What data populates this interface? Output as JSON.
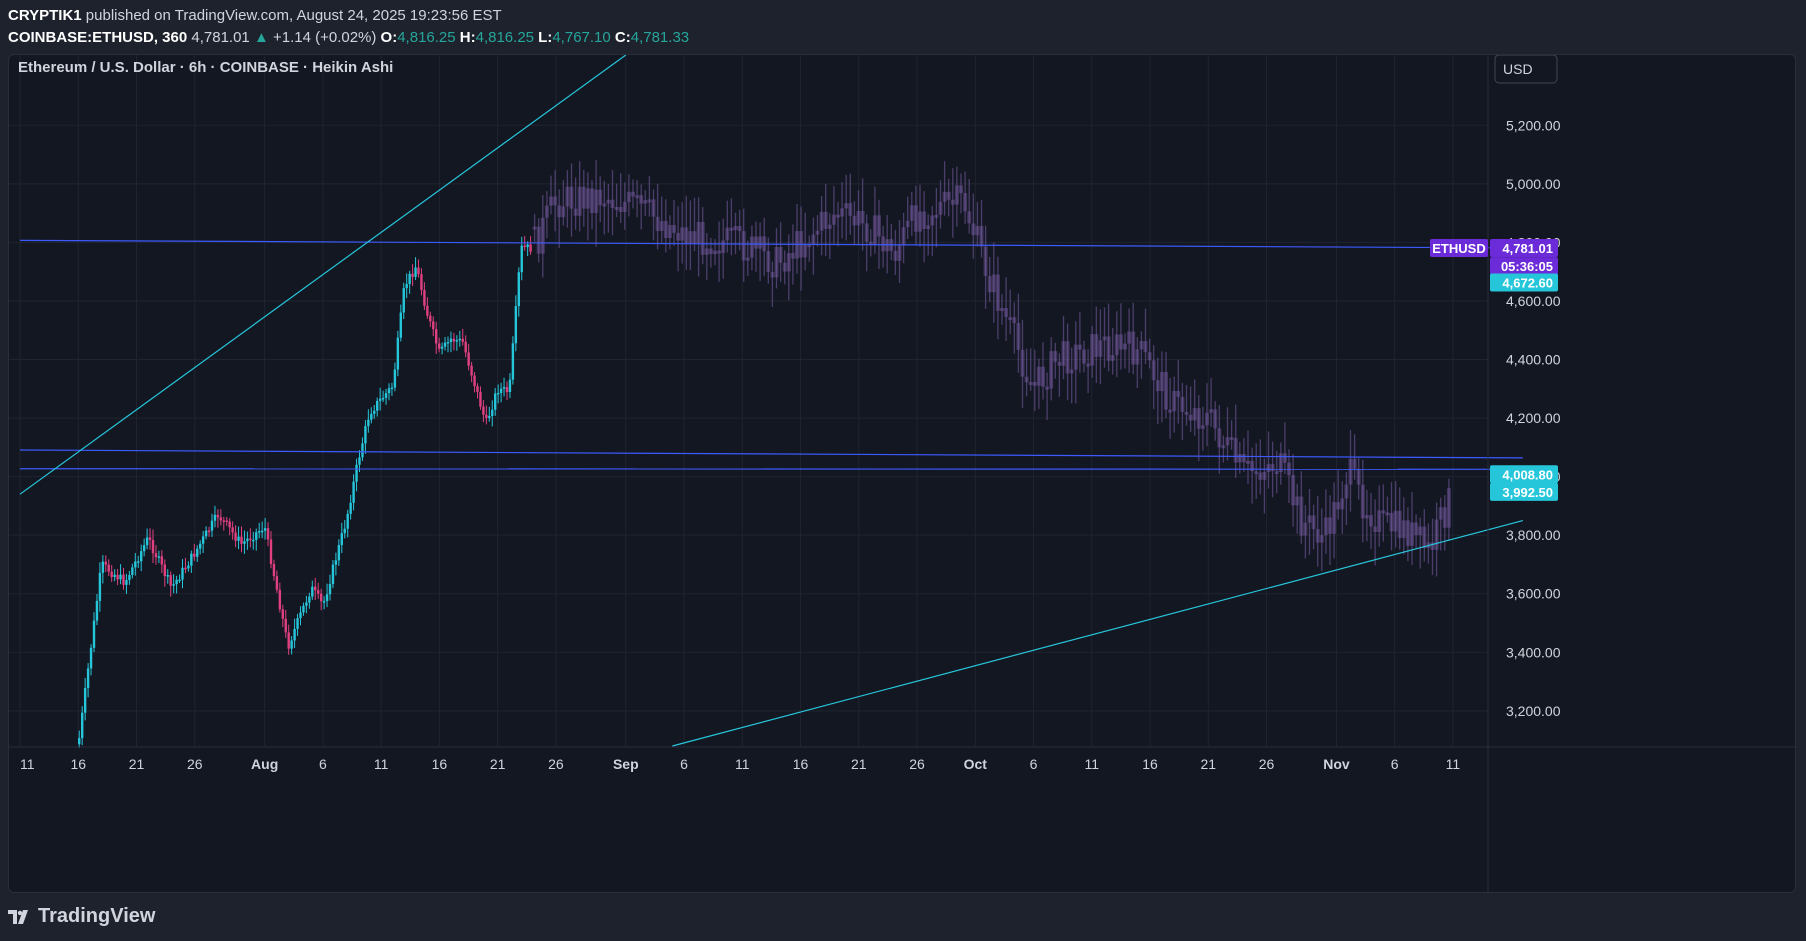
{
  "header": {
    "author": "CRYPTIK1",
    "published_text": "published on TradingView.com, August 24, 2025 19:23:56 EST",
    "symbol": "COINBASE:ETHUSD, 360",
    "last": "4,781.01",
    "change_arrow": "▲",
    "change": "+1.14 (+0.02%)",
    "o_label": "O:",
    "o_value": "4,816.25",
    "h_label": "H:",
    "h_value": "4,816.25",
    "l_label": "L:",
    "l_value": "4,767.10",
    "c_label": "C:",
    "c_value": "4,781.33"
  },
  "chart_title": "Ethereum / U.S. Dollar · 6h · COINBASE · Heikin Ashi",
  "currency_button": "USD",
  "footer_brand": "TradingView",
  "colors": {
    "background": "#131722",
    "up": "#26c6da",
    "down": "#e0407f",
    "projection": "#7b5ea7",
    "trendline": "#26c6da",
    "hline": "#3d5afe",
    "ethusd_badge": "#6c2bd9"
  },
  "chart_data": {
    "type": "candlestick",
    "title": "Ethereum / U.S. Dollar · 6h · COINBASE · Heikin Ashi",
    "x_ticks": [
      "11",
      "16",
      "21",
      "26",
      "Aug",
      "6",
      "11",
      "16",
      "21",
      "26",
      "Sep",
      "6",
      "11",
      "16",
      "21",
      "26",
      "Oct",
      "6",
      "11",
      "16",
      "21",
      "26",
      "Nov",
      "6",
      "11"
    ],
    "y_ticks": [
      "5,200.00",
      "5,000.00",
      "4,800.00",
      "4,600.00",
      "4,400.00",
      "4,200.00",
      "4,000.00",
      "3,800.00",
      "3,600.00",
      "3,400.00",
      "3,200.00"
    ],
    "ylim": [
      3080,
      5440
    ],
    "candle_anchors": [
      {
        "date": "Jul 16",
        "price": 3080
      },
      {
        "date": "Jul 18",
        "price": 3700
      },
      {
        "date": "Jul 20",
        "price": 3640
      },
      {
        "date": "Jul 22",
        "price": 3790
      },
      {
        "date": "Jul 24",
        "price": 3620
      },
      {
        "date": "Jul 26",
        "price": 3740
      },
      {
        "date": "Jul 28",
        "price": 3870
      },
      {
        "date": "Jul 30",
        "price": 3770
      },
      {
        "date": "Aug 1",
        "price": 3830
      },
      {
        "date": "Aug 3",
        "price": 3420
      },
      {
        "date": "Aug 5",
        "price": 3620
      },
      {
        "date": "Aug 6",
        "price": 3560
      },
      {
        "date": "Aug 8",
        "price": 3850
      },
      {
        "date": "Aug 9",
        "price": 4050
      },
      {
        "date": "Aug 10",
        "price": 4220
      },
      {
        "date": "Aug 12",
        "price": 4310
      },
      {
        "date": "Aug 13",
        "price": 4650
      },
      {
        "date": "Aug 14",
        "price": 4720
      },
      {
        "date": "Aug 15",
        "price": 4550
      },
      {
        "date": "Aug 16",
        "price": 4420
      },
      {
        "date": "Aug 17",
        "price": 4470
      },
      {
        "date": "Aug 18",
        "price": 4460
      },
      {
        "date": "Aug 19",
        "price": 4320
      },
      {
        "date": "Aug 20",
        "price": 4180
      },
      {
        "date": "Aug 21",
        "price": 4300
      },
      {
        "date": "Aug 22",
        "price": 4290
      },
      {
        "date": "Aug 23",
        "price": 4780
      },
      {
        "date": "Aug 24",
        "price": 4781
      }
    ],
    "projection_anchors": [
      {
        "date": "Aug 24",
        "price": 4781
      },
      {
        "date": "Aug 26",
        "price": 4940
      },
      {
        "date": "Aug 30",
        "price": 4960
      },
      {
        "date": "Sep 2",
        "price": 4920
      },
      {
        "date": "Sep 6",
        "price": 4830
      },
      {
        "date": "Sep 11",
        "price": 4790
      },
      {
        "date": "Sep 14",
        "price": 4730
      },
      {
        "date": "Sep 16",
        "price": 4800
      },
      {
        "date": "Sep 19",
        "price": 4900
      },
      {
        "date": "Sep 22",
        "price": 4850
      },
      {
        "date": "Sep 24",
        "price": 4760
      },
      {
        "date": "Sep 26",
        "price": 4900
      },
      {
        "date": "Sep 30",
        "price": 4940
      },
      {
        "date": "Oct 2",
        "price": 4700
      },
      {
        "date": "Oct 4",
        "price": 4500
      },
      {
        "date": "Oct 6",
        "price": 4300
      },
      {
        "date": "Oct 8",
        "price": 4400
      },
      {
        "date": "Oct 12",
        "price": 4450
      },
      {
        "date": "Oct 15",
        "price": 4430
      },
      {
        "date": "Oct 18",
        "price": 4250
      },
      {
        "date": "Oct 21",
        "price": 4200
      },
      {
        "date": "Oct 24",
        "price": 4010
      },
      {
        "date": "Oct 27",
        "price": 4050
      },
      {
        "date": "Oct 29",
        "price": 3850
      },
      {
        "date": "Oct 31",
        "price": 3790
      },
      {
        "date": "Nov 2",
        "price": 4020
      },
      {
        "date": "Nov 3",
        "price": 3930
      },
      {
        "date": "Nov 5",
        "price": 3830
      },
      {
        "date": "Nov 7",
        "price": 3820
      },
      {
        "date": "Nov 9",
        "price": 3740
      },
      {
        "date": "Nov 11",
        "price": 3960
      }
    ],
    "horizontal_lines": [
      {
        "start": {
          "date": "Jul 11",
          "price": 4807
        },
        "end": {
          "date": "Nov 17",
          "price": 4781
        }
      },
      {
        "start": {
          "date": "Jul 11",
          "price": 4091
        },
        "end": {
          "date": "Nov 17",
          "price": 4064
        }
      },
      {
        "start": {
          "date": "Jul 11",
          "price": 4027
        },
        "end": {
          "date": "Nov 17",
          "price": 4025
        }
      }
    ],
    "trend_lines": [
      {
        "start": {
          "date": "Jul 11",
          "price": 3940
        },
        "end": {
          "date": "Sep 1",
          "price": 5440
        }
      },
      {
        "start": {
          "date": "Sep 5",
          "price": 3080
        },
        "end": {
          "date": "Nov 17",
          "price": 3850
        }
      }
    ],
    "price_labels": [
      {
        "text": "4,781.01",
        "price": 4781,
        "color": "#6c2bd9",
        "tag": "ETHUSD"
      },
      {
        "text": "05:36:05",
        "price": 4719,
        "color": "#6c2bd9"
      },
      {
        "text": "4,672.60",
        "price": 4663,
        "color": "#26c6da"
      },
      {
        "text": "4,008.80",
        "price": 4008,
        "color": "#26c6da"
      },
      {
        "text": "3,992.50",
        "price": 3948,
        "color": "#26c6da"
      }
    ]
  }
}
